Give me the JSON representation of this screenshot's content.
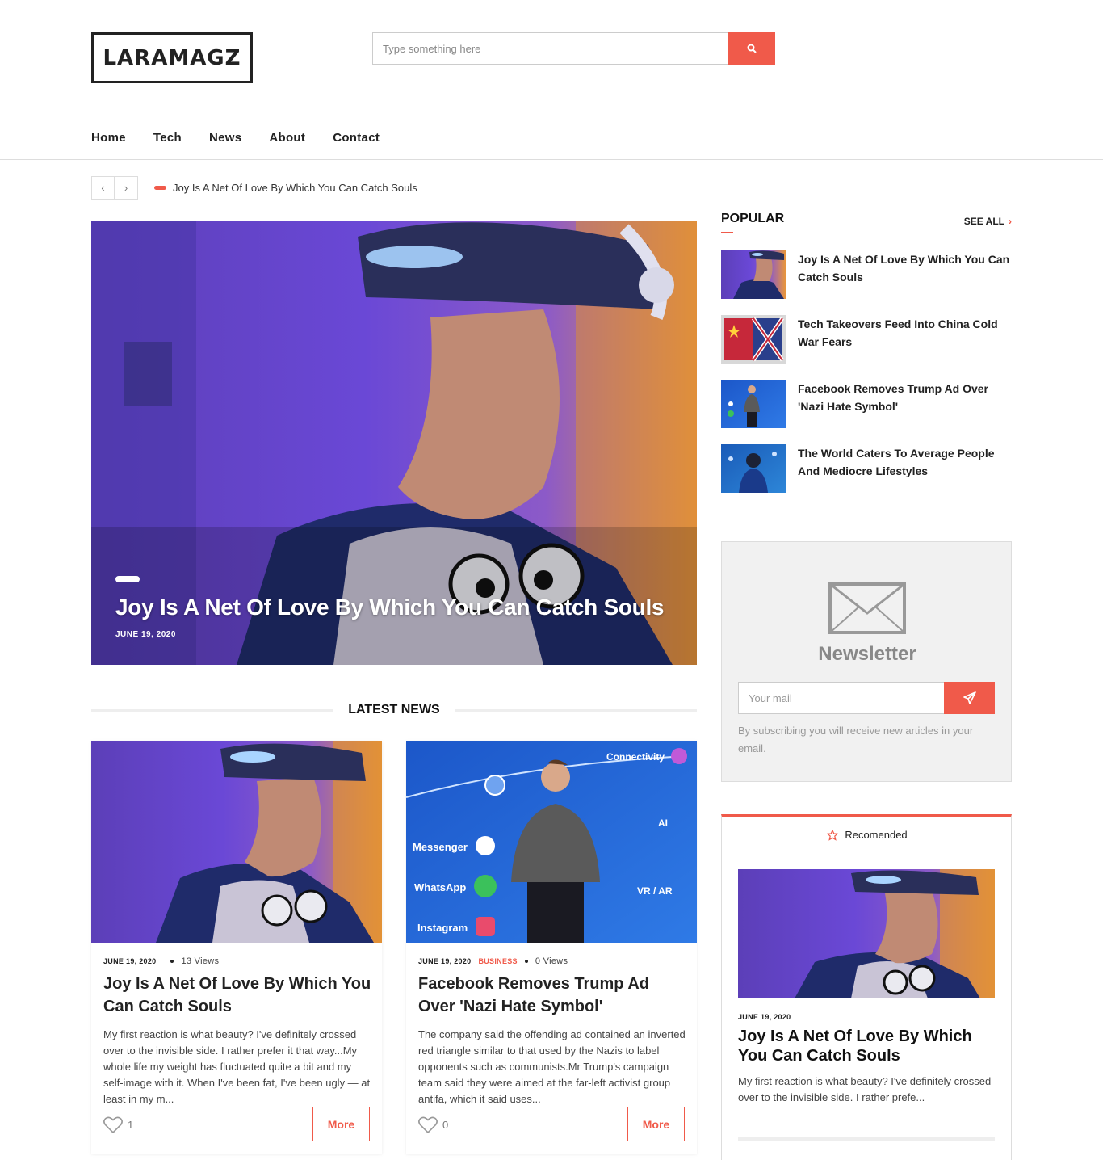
{
  "header": {
    "logo": "LARAMAGZ",
    "search_placeholder": "Type something here"
  },
  "nav": [
    "Home",
    "Tech",
    "News",
    "About",
    "Contact"
  ],
  "ticker": {
    "text": "Joy Is A Net Of Love By Which You Can Catch Souls"
  },
  "hero": {
    "title": "Joy Is A Net Of Love By Which You Can Catch Souls",
    "date": "JUNE 19, 2020"
  },
  "latest": {
    "heading": "LATEST NEWS"
  },
  "cards": [
    {
      "date": "JUNE 19, 2020",
      "category": "",
      "views": "13 Views",
      "title": "Joy Is A Net Of Love By Which You Can Catch Souls",
      "excerpt": "My first reaction is what beauty? I've definitely crossed over to the invisible side. I rather prefer it that way...My whole life my weight has fluctuated quite a bit and my self-image with it. When I've been fat, I've been ugly — at least in my m...",
      "likes": "1",
      "more": "More"
    },
    {
      "date": "JUNE 19, 2020",
      "category": "BUSINESS",
      "views": "0 Views",
      "title": "Facebook Removes Trump Ad Over 'Nazi Hate Symbol'",
      "excerpt": "The company said the offending ad contained an inverted red triangle similar to that used by the Nazis to label opponents such as communists.Mr Trump's campaign team said they were aimed at the far-left activist group antifa, which it said uses...",
      "likes": "0",
      "more": "More"
    }
  ],
  "popular": {
    "title": "POPULAR",
    "see_all": "SEE ALL",
    "items": [
      "Joy Is A Net Of Love By Which You Can Catch Souls",
      "Tech Takeovers Feed Into China Cold War Fears",
      "Facebook Removes Trump Ad Over 'Nazi Hate Symbol'",
      "The World Caters To Average People And Mediocre Lifestyles"
    ]
  },
  "newsletter": {
    "title": "Newsletter",
    "placeholder": "Your mail",
    "note": "By subscribing you will receive new articles in your email."
  },
  "recommended": {
    "heading": "Recomended",
    "date": "JUNE 19, 2020",
    "title": "Joy Is A Net Of Love By Which You Can Catch Souls",
    "excerpt": "My first reaction is what beauty? I've definitely crossed over to the invisible side. I rather prefe..."
  },
  "colors": {
    "accent": "#f05a4a",
    "text": "#222222"
  }
}
